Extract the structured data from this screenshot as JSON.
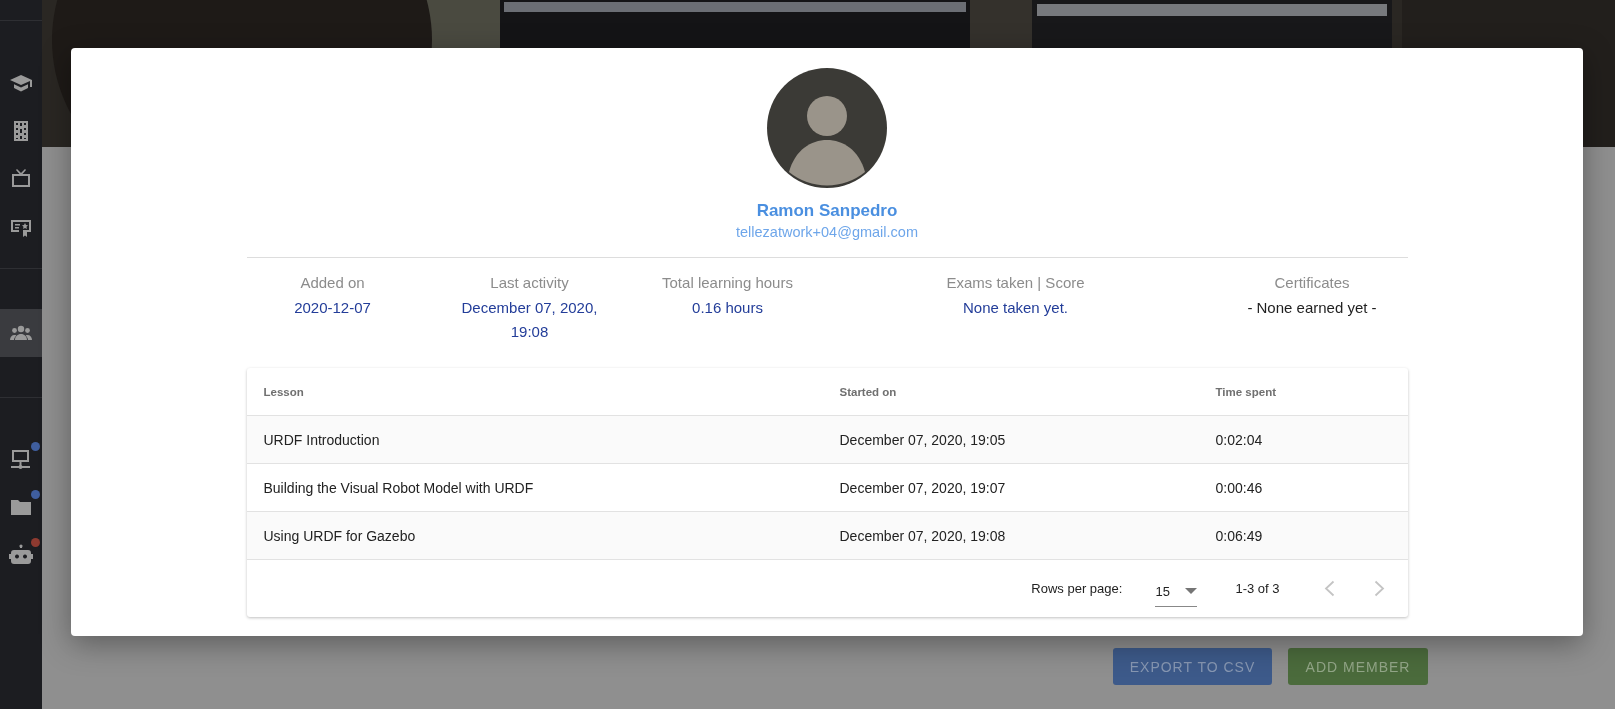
{
  "sidebar": {
    "groups": [
      [
        {
          "selected": false
        },
        {
          "selected": false
        },
        {
          "selected": false
        },
        {
          "selected": false
        }
      ],
      [
        {
          "selected": true
        }
      ],
      [
        {
          "selected": false,
          "color": "#3f5e9e"
        },
        {
          "selected": false,
          "color": "#3f5e9e"
        },
        {
          "selected": false,
          "color": "#8e3a30"
        }
      ]
    ]
  },
  "page_actions": [
    {
      "label": "EXPORT TO CSV",
      "kind": "primary"
    },
    {
      "label": "ADD MEMBER",
      "kind": "success"
    }
  ],
  "profile": {
    "name": "Ramon Sanpedro",
    "email": "tellezatwork+04@gmail.com"
  },
  "stats": [
    {
      "label": "Added on",
      "value": "2020-12-07",
      "kind": "value"
    },
    {
      "label": "Last activity",
      "value": "December 07, 2020, 19:08",
      "kind": "value"
    },
    {
      "label": "Total learning hours",
      "value": "0.16 hours",
      "kind": "value"
    },
    {
      "label": "Exams taken | Score",
      "value": "None taken yet.",
      "kind": "value"
    },
    {
      "label": "Certificates",
      "value": "- None earned yet -",
      "kind": "note"
    }
  ],
  "lessons_table": {
    "columns": [
      "Lesson",
      "Started on",
      "Time spent"
    ],
    "rows": [
      [
        "URDF Introduction",
        "December 07, 2020, 19:05",
        "0:02:04"
      ],
      [
        "Building the Visual Robot Model with URDF",
        "December 07, 2020, 19:07",
        "0:00:46"
      ],
      [
        "Using URDF for Gazebo",
        "December 07, 2020, 19:08",
        "0:06:49"
      ]
    ],
    "pagination": {
      "rows_per_page_label": "Rows per page:",
      "rows_per_page": "15",
      "range": "1-3 of 3",
      "previous": {
        "disabled": true
      },
      "next": {
        "disabled": true
      }
    }
  }
}
